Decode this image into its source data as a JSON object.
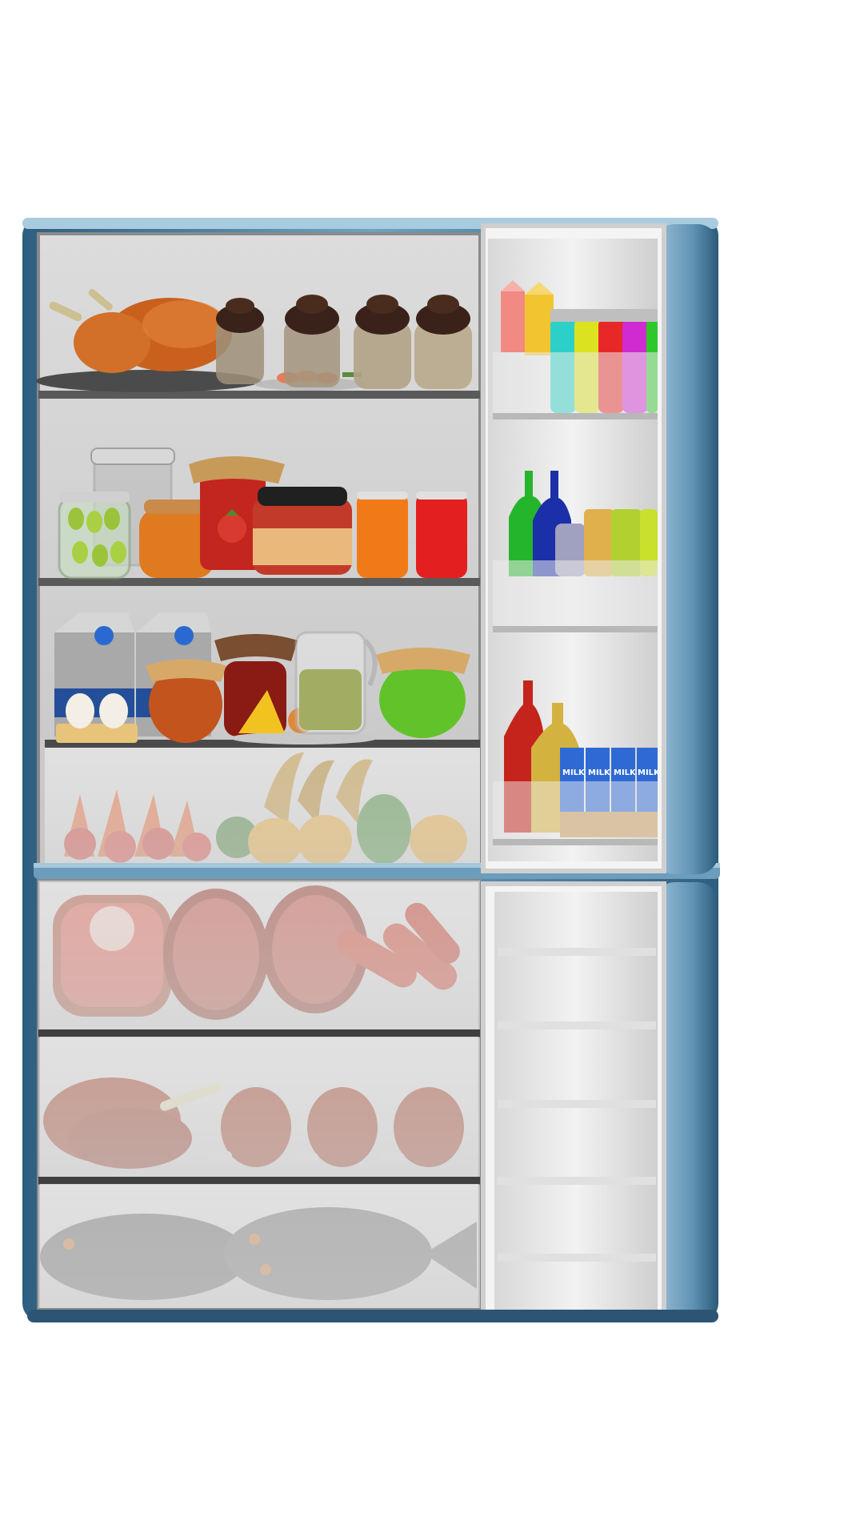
{
  "scene": {
    "kind": "open-refrigerator",
    "colors": {
      "body": "#5f93b4",
      "body_dark": "#2e5f80",
      "interior": "#cfcfcf",
      "shelf": "#5a5a5a",
      "frost": "#e6e6e6"
    }
  },
  "milk_cartons": {
    "label": "MILK",
    "count": 4
  },
  "compartments": [
    {
      "name": "top-shelf",
      "items": [
        "roast chicken",
        "chocolate puddings",
        "shrimp plate"
      ]
    },
    {
      "name": "middle-shelf",
      "items": [
        "pickle jar",
        "honey jar",
        "strawberry jam",
        "sauce jar",
        "orange can",
        "red can"
      ]
    },
    {
      "name": "lower-shelf",
      "items": [
        "milk cartons",
        "eggs",
        "honey pot",
        "jam jar",
        "cheese",
        "juice pitcher",
        "lime jam"
      ]
    },
    {
      "name": "crisper-drawer",
      "items": [
        "carrots",
        "tomatoes",
        "peppers",
        "oranges",
        "bananas"
      ]
    },
    {
      "name": "freezer-meat",
      "items": [
        "steak",
        "salami",
        "sausages"
      ]
    },
    {
      "name": "freezer-poultry",
      "items": [
        "chicken",
        "drumsticks"
      ]
    },
    {
      "name": "freezer-fish",
      "items": [
        "fish"
      ]
    },
    {
      "name": "door-bottles",
      "items": [
        "juice cartons",
        "colored bottles"
      ]
    },
    {
      "name": "door-sauces",
      "items": [
        "green bottle",
        "blue bottle",
        "spice jars"
      ]
    },
    {
      "name": "door-milk",
      "items": [
        "red bottle",
        "oil bottle",
        "milk cartons"
      ]
    }
  ]
}
